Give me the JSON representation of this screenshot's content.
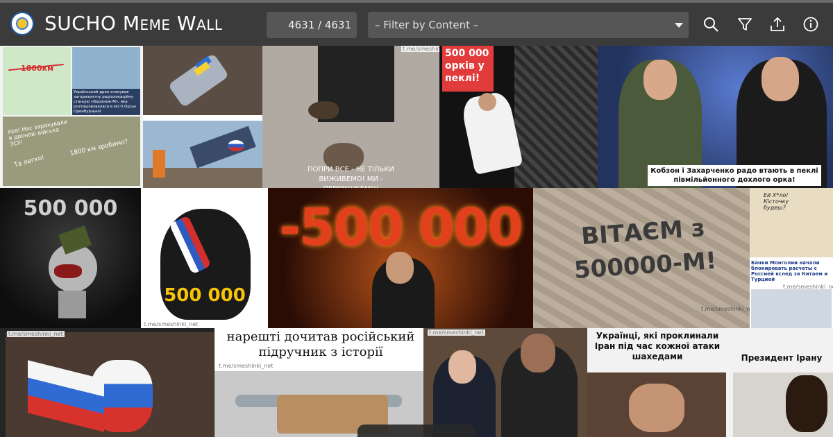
{
  "header": {
    "title": "SUCHO Meme Wall",
    "counter": "4631 / 4631",
    "filter_placeholder": "– Filter by Content –",
    "icons": [
      "search-icon",
      "filter-icon",
      "upload-icon",
      "info-icon"
    ]
  },
  "colors": {
    "topbar": "#3b3b3b",
    "control": "#565656",
    "text": "#ffffff"
  },
  "tiles": {
    "map": {
      "distance": "1800км",
      "caption": "Український дрон атакував загоризонтну радіолокаційну станцію «Воронеж-М», яка розташовувалася в місті Орськ Оренбурзької",
      "speech1": "Ура! Нас зарахували в дронові війська ЗСУ!",
      "speech2": "1800 км зробимо?",
      "speech3": "Та легко!"
    },
    "cat": {
      "caption": "ПОПРИ ВСЕ - НЕ ТІЛЬКИ ВИЖИВЕМО! МИ - ПЕРЕМОЖЕМО!",
      "wm": "t.me/smeshinki_net"
    },
    "dancer": {
      "caption": "500 000 орків у пеклі!"
    },
    "kobzon": {
      "caption": "Кобзон і Захарченко радо втають в пеклі півмільйонного дохлого орка!"
    },
    "grinder": {
      "caption": "500 000"
    },
    "bag": {
      "caption": "500 000",
      "wm": "t.me/smeshinki_net"
    },
    "fire": {
      "caption": "-500 000"
    },
    "field": {
      "caption": "ВІТАЄМ з 500000-М!",
      "wm": "t.me/smeshinki_net"
    },
    "mongol": {
      "speech": "Ей Х*ло! Кісточку будеш?",
      "headline": "Банки Монголии начали блокировать расчеты с Россией вслед за Китаем и Турцией",
      "wm": "t.me/smeshinki_net"
    },
    "tp": {
      "wm": "t.me/smeshinki_net"
    },
    "book": {
      "caption": "нарешті дочитав російський підручник з історії",
      "wm": "t.me/smeshinki_net"
    },
    "putin": {
      "wm": "t.me/smeshinki_net"
    },
    "shining": {
      "caption1": "Українці, які проклинали Іран під час кожної атаки шахедами",
      "caption2": "Президент Ірану"
    }
  }
}
